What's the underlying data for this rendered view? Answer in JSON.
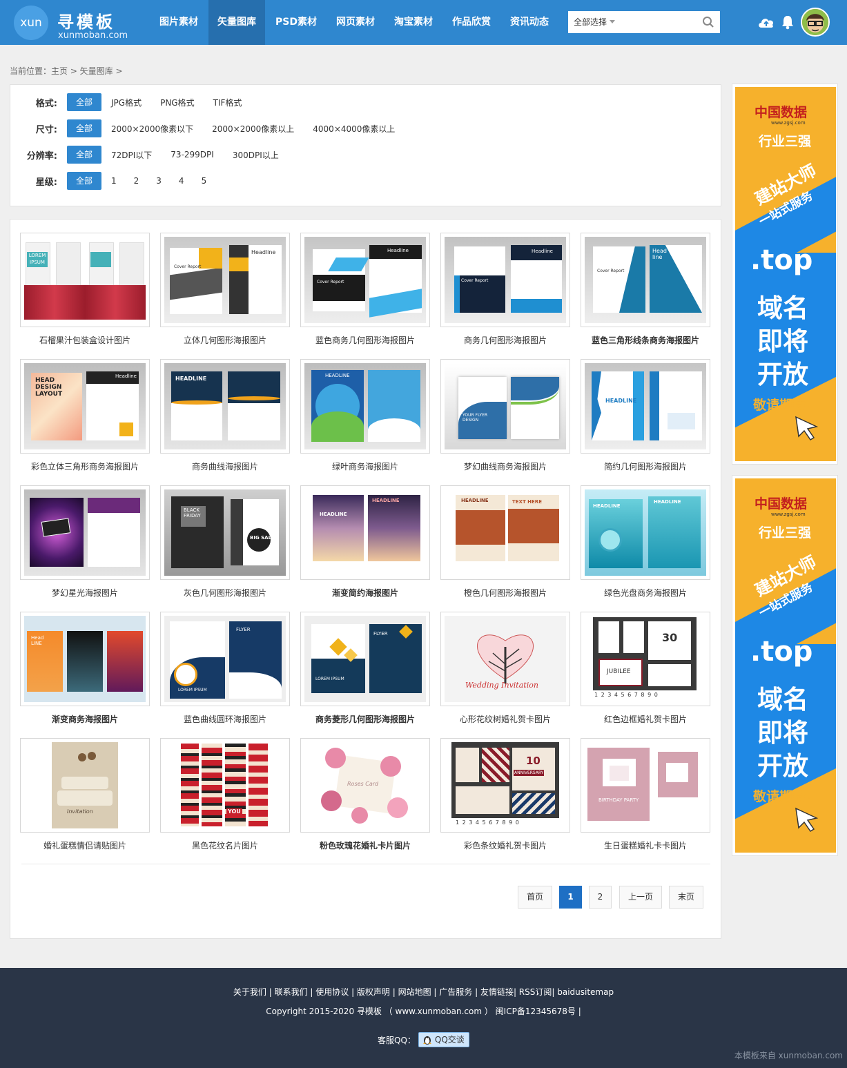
{
  "header": {
    "logo_circle": "xun",
    "logo_cn": "寻模板",
    "logo_en": "xunmoban.com",
    "nav": [
      "图片素材",
      "矢量图库",
      "PSD素材",
      "网页素材",
      "淘宝素材",
      "作品欣赏",
      "资讯动态"
    ],
    "active_nav_index": 1,
    "search_select": "全部选择",
    "icons": [
      "cloud-upload-icon",
      "bell-icon",
      "search-icon"
    ]
  },
  "breadcrumb": "当前位置：主页 > 矢量图库 >",
  "filters": [
    {
      "label": "格式:",
      "options": [
        "全部",
        "JPG格式",
        "PNG格式",
        "TIF格式"
      ]
    },
    {
      "label": "尺寸:",
      "options": [
        "全部",
        "2000×2000像素以下",
        "2000×2000像素以上",
        "4000×4000像素以上"
      ]
    },
    {
      "label": "分辨率:",
      "options": [
        "全部",
        "72DPI以下",
        "73-299DPI",
        "300DPI以上"
      ]
    },
    {
      "label": "星级:",
      "options": [
        "全部",
        "1",
        "2",
        "3",
        "4",
        "5"
      ]
    }
  ],
  "items": [
    {
      "title": "石榴果汁包装盒设计图片",
      "bold": false
    },
    {
      "title": "立体几何图形海报图片",
      "bold": false
    },
    {
      "title": "蓝色商务几何图形海报图片",
      "bold": false
    },
    {
      "title": "商务几何图形海报图片",
      "bold": false
    },
    {
      "title": "蓝色三角形线条商务海报图片",
      "bold": true
    },
    {
      "title": "彩色立体三角形商务海报图片",
      "bold": false
    },
    {
      "title": "商务曲线海报图片",
      "bold": false
    },
    {
      "title": "绿叶商务海报图片",
      "bold": false
    },
    {
      "title": "梦幻曲线商务海报图片",
      "bold": false
    },
    {
      "title": "简约几何图形海报图片",
      "bold": false
    },
    {
      "title": "梦幻星光海报图片",
      "bold": false
    },
    {
      "title": "灰色几何图形海报图片",
      "bold": false
    },
    {
      "title": "渐变简约海报图片",
      "bold": true
    },
    {
      "title": "橙色几何图形海报图片",
      "bold": false
    },
    {
      "title": "绿色光盘商务海报图片",
      "bold": false
    },
    {
      "title": "渐变商务海报图片",
      "bold": true
    },
    {
      "title": "蓝色曲线圆环海报图片",
      "bold": false
    },
    {
      "title": "商务菱形几何图形海报图片",
      "bold": true
    },
    {
      "title": "心形花纹树婚礼贺卡图片",
      "bold": false
    },
    {
      "title": "红色边框婚礼贺卡图片",
      "bold": false
    },
    {
      "title": "婚礼蛋糕情侣请贴图片",
      "bold": false
    },
    {
      "title": "黑色花纹名片图片",
      "bold": false
    },
    {
      "title": "粉色玫瑰花婚礼卡片图片",
      "bold": true
    },
    {
      "title": "彩色条纹婚礼贺卡图片",
      "bold": false
    },
    {
      "title": "生日蛋糕婚礼卡卡图片",
      "bold": false
    }
  ],
  "thumb_text": {
    "t0a": "LOREM IPSUM",
    "t1a": "Cover Report",
    "t1b": "Headline",
    "t2a": "Headline",
    "t2b": "Cover Report",
    "t3a": "Headline",
    "t3b": "Cover Report",
    "t4a": "Head line",
    "t4b": "Cover Report",
    "t5a": "HEAD DESIGN LAYOUT",
    "t5b": "Headline",
    "t6a": "HEADLINE",
    "t7a": "HEADLINE",
    "t8a": "YOUR FLYER DESIGN",
    "t9a": "HEADLINE",
    "t11a": "BLACK FRIDAY",
    "t11b": "BIG SALE",
    "t12a": "HEADLINE",
    "t12b": "HEADLINE",
    "t13a": "HEADLINE",
    "t13b": "TEXT HERE",
    "t14a": "HEADLINE",
    "t14b": "HEADLINE",
    "t15a": "Head LINE",
    "t16a": "LOREM IPSUM",
    "t16b": "FLYER",
    "t17a": "LOREM IPSUM",
    "t17b": "FLYER",
    "t18a": "Wedding Invitation",
    "t19a": "30",
    "t19b": "JUBILEE",
    "t19c": "1 2 3 4 5 6 7 8 9 0",
    "t20a": "Invitation",
    "t21a": "YOU",
    "t22a": "Roses Card",
    "t23a": "10",
    "t23b": "ANNIVERSARY",
    "t23c": "1 2 3 4 5 6 7 8 9 0",
    "t24a": "BIRTHDAY PARTY"
  },
  "pagination": [
    "首页",
    "1",
    "2",
    "上一页",
    "末页"
  ],
  "current_page": "1",
  "ads": [
    {
      "brand": "中国数据",
      "brand_url": "www.zgsj.com",
      "line1": "行业三强",
      "line2": "建站大师",
      "line3": "一站式服务",
      "line4": ".top",
      "line5": "域名",
      "line6": "即将",
      "line7": "开放",
      "line8": "敬请期待!"
    },
    {
      "brand": "中国数据",
      "brand_url": "www.zgsj.com",
      "line1": "行业三强",
      "line2": "建站大师",
      "line3": "一站式服务",
      "line4": ".top",
      "line5": "域名",
      "line6": "即将",
      "line7": "开放",
      "line8": "敬请期待!"
    }
  ],
  "footer": {
    "links": "关于我们 | 联系我们 | 使用协议 | 版权声明 | 网站地图 | 广告服务 | 友情链接| RSS订阅| baidusitemap",
    "copyright": "Copyright 2015-2020 寻模板 （ www.xunmoban.com ） 闽ICP备12345678号 |",
    "qq_label": "客服QQ：",
    "qq_button": "QQ交谈",
    "watermark": "本模板来自 xunmoban.com"
  }
}
